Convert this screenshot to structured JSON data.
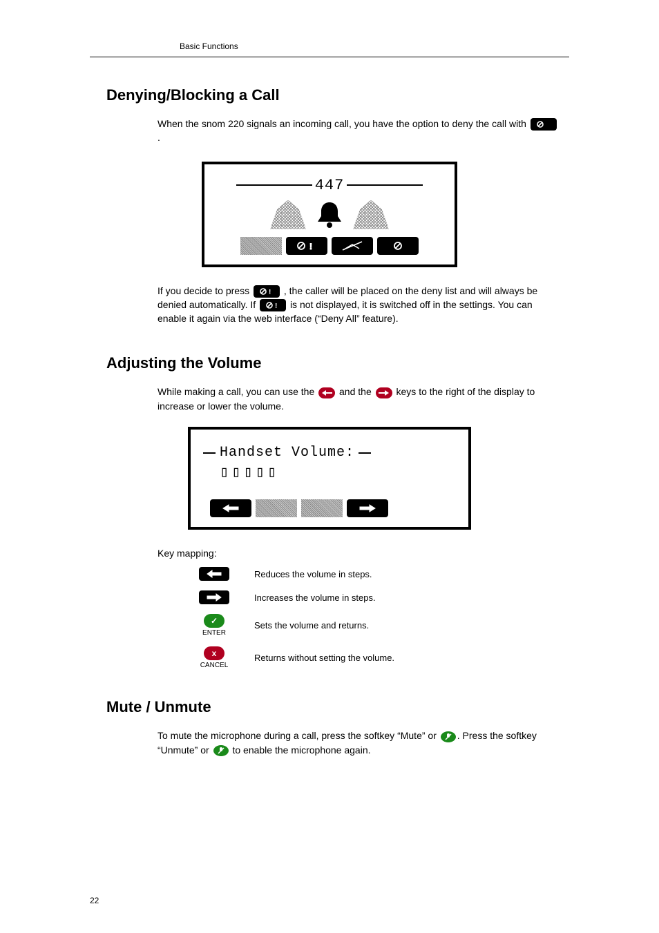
{
  "header": "Basic Functions",
  "page_number": "22",
  "h_deny": "Denying/Blocking a Call",
  "p_deny_1a": "When the snom 220 signals an incoming call, you have the option to deny the call with ",
  "p_deny_1b": ".",
  "lcd1_title": "447",
  "p_deny_2a": "If you decide to press ",
  "p_deny_2b": ", the caller will be placed on the deny list and will always be denied automatically.  If ",
  "p_deny_2c": " is not displayed, it is switched off in the settings. You can enable it again via the web interface (“Deny All” feature).",
  "h_vol": "Adjusting the Volume",
  "p_vol_a": "While making a call, you can use the ",
  "p_vol_b": " and the ",
  "p_vol_c": " keys to the right of the display to increase or lower the volume.",
  "lcd2_title": "Handset Volume:",
  "lcd2_blocks": "▯▯▯▯▯",
  "keymap_label": "Key mapping:",
  "km": [
    {
      "label": "",
      "desc": "Reduces the volume in steps."
    },
    {
      "label": "",
      "desc": "Increases the volume in steps."
    },
    {
      "label": "ENTER",
      "desc": "Sets the volume and returns."
    },
    {
      "label": "CANCEL",
      "desc": "Returns without setting the volume."
    }
  ],
  "h_mute": "Mute / Unmute",
  "p_mute_a": "To mute the microphone during a call, press the softkey “Mute” or  ",
  "p_mute_b": ". Press the softkey “Unmute” or ",
  "p_mute_c": " to enable the microphone again."
}
